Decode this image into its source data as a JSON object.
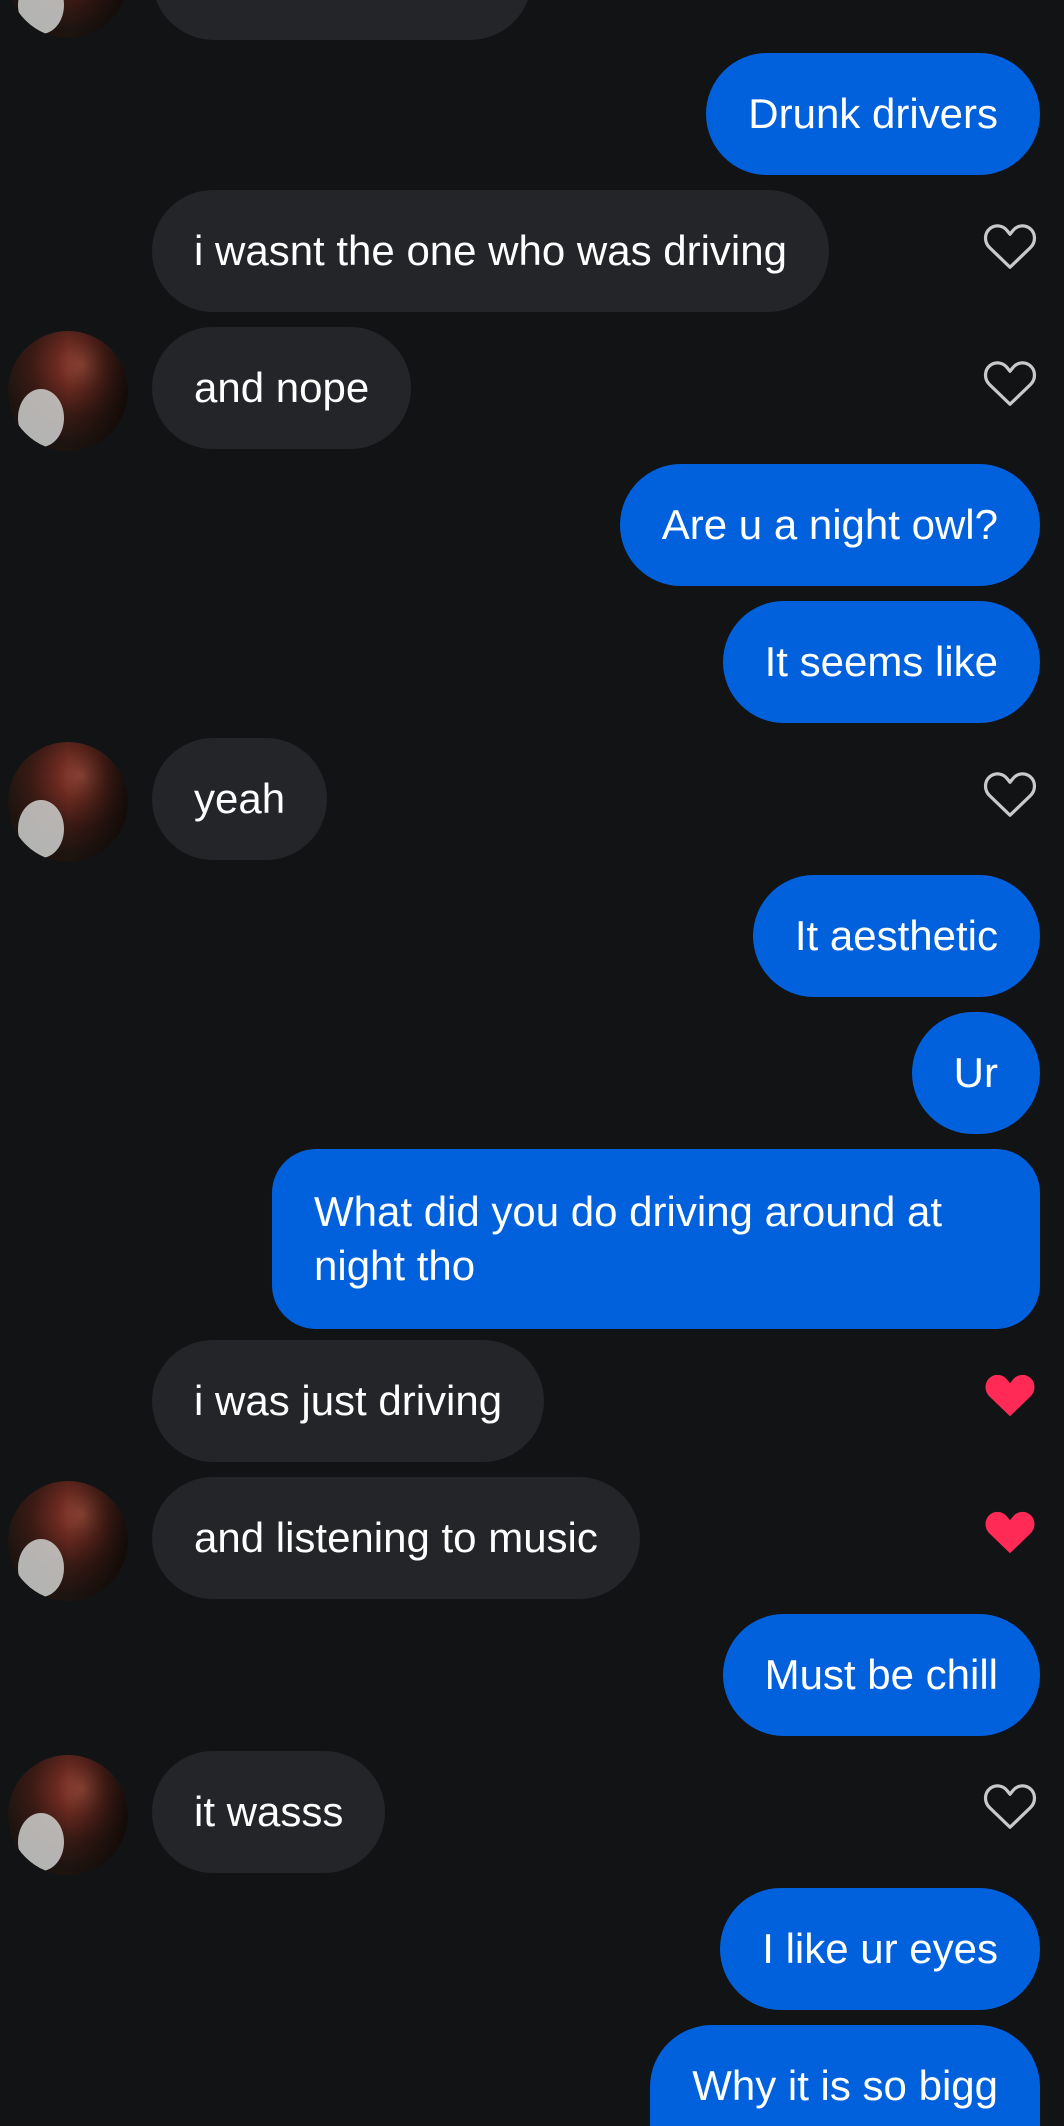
{
  "colors": {
    "background": "#111315",
    "incoming_bubble": "#242529",
    "outgoing_bubble": "#0161dd",
    "heart_outline": "#c9c9cc",
    "heart_liked": "#ff2a55"
  },
  "messages": [
    {
      "direction": "incoming",
      "text": "",
      "partially_visible": true
    },
    {
      "direction": "outgoing",
      "text": "Drunk drivers"
    },
    {
      "direction": "incoming",
      "text": "i wasnt the one who was driving",
      "liked": false
    },
    {
      "direction": "incoming",
      "text": "and nope",
      "liked": false,
      "avatar": true
    },
    {
      "direction": "outgoing",
      "text": "Are u a night owl?"
    },
    {
      "direction": "outgoing",
      "text": "It seems like"
    },
    {
      "direction": "incoming",
      "text": "yeah",
      "liked": false,
      "avatar": true
    },
    {
      "direction": "outgoing",
      "text": "It aesthetic"
    },
    {
      "direction": "outgoing",
      "text": "Ur"
    },
    {
      "direction": "outgoing",
      "text": "What did you do driving around at night tho"
    },
    {
      "direction": "incoming",
      "text": "i was just driving",
      "liked": true
    },
    {
      "direction": "incoming",
      "text": "and listening to music",
      "liked": true,
      "avatar": true
    },
    {
      "direction": "outgoing",
      "text": "Must be chill"
    },
    {
      "direction": "incoming",
      "text": "it wasss",
      "liked": false,
      "avatar": true
    },
    {
      "direction": "outgoing",
      "text": "I like ur eyes"
    },
    {
      "direction": "outgoing",
      "text": "Why it is so bigg",
      "partially_visible": true
    }
  ]
}
